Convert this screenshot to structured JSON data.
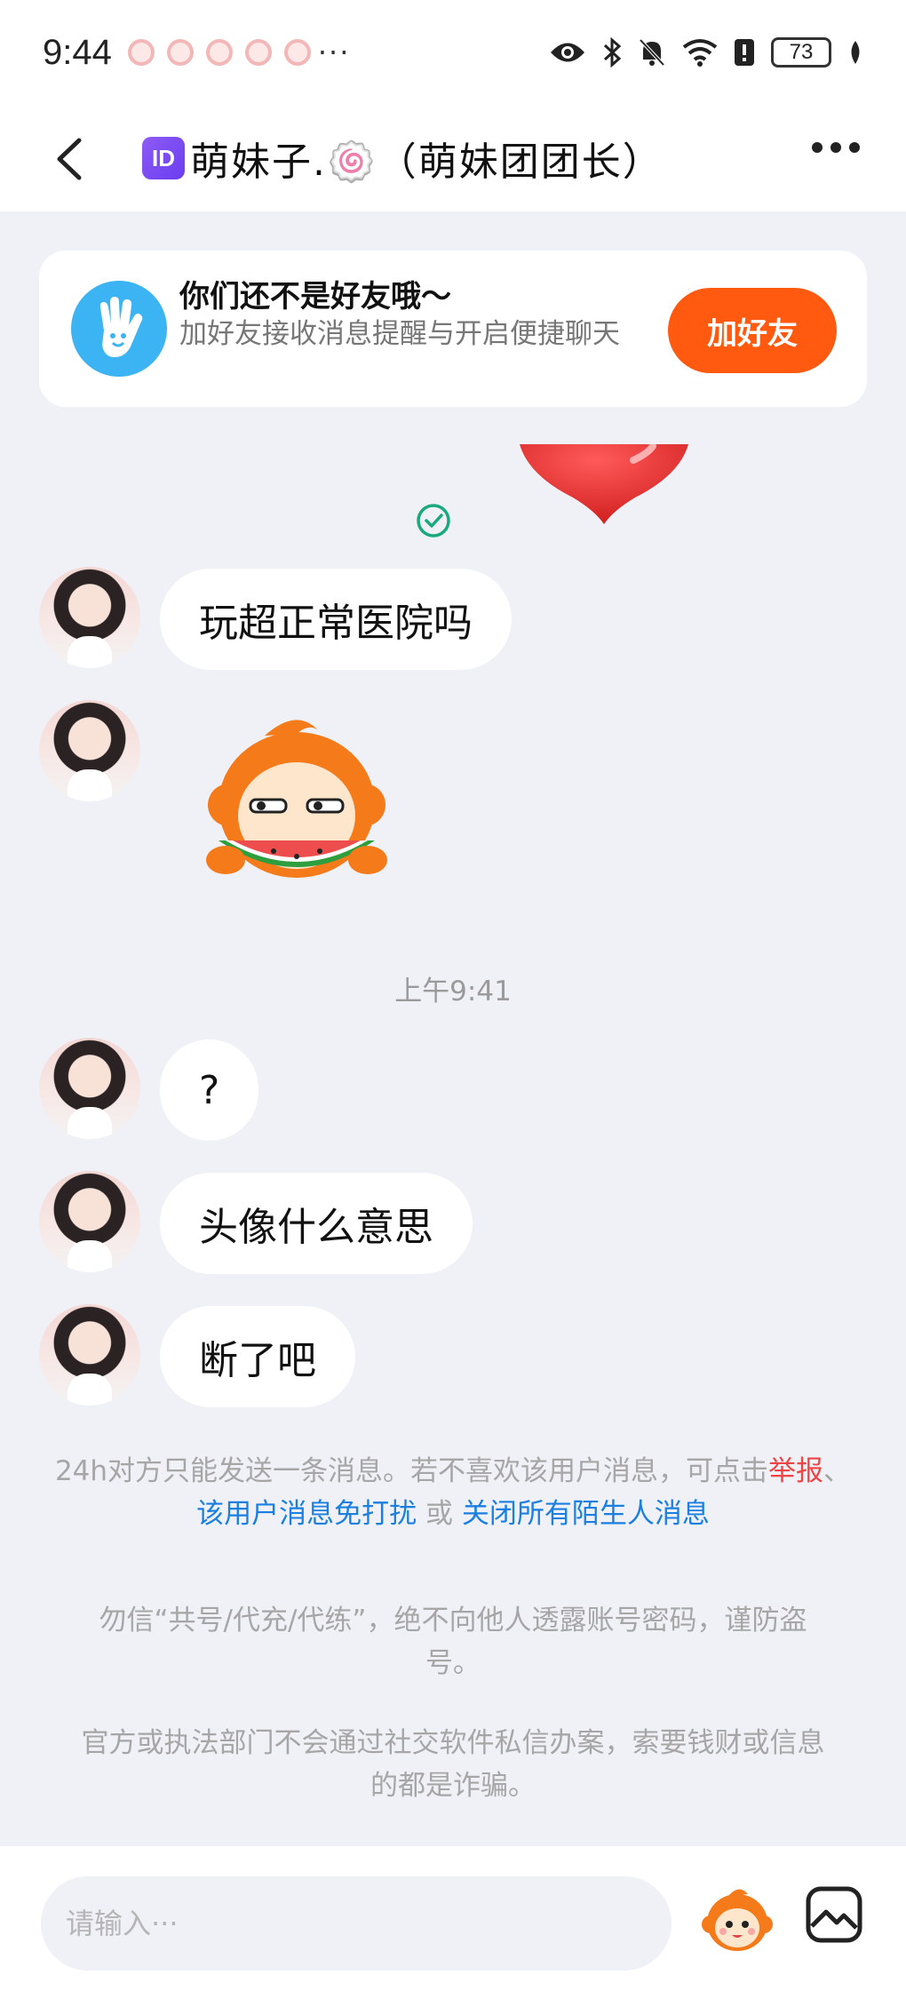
{
  "status_bar": {
    "time": "9:44",
    "overflow": "···",
    "battery": "73",
    "icons": [
      "eye-icon",
      "bluetooth-icon",
      "mute-bell-icon",
      "wifi-icon",
      "alert-icon",
      "battery-icon",
      "leaf-icon"
    ]
  },
  "header": {
    "id_badge": "ID",
    "title": "萌妹子.🍥（萌妹团团长）"
  },
  "friend_banner": {
    "title": "你们还不是好友哦～",
    "subtitle": "加好友接收消息提醒与开启便捷聊天",
    "button": "加好友"
  },
  "messages": [
    {
      "type": "text",
      "text": "玩超正常医院吗"
    },
    {
      "type": "sticker",
      "sticker": "watermelon-monkey-sticker"
    },
    {
      "type": "text",
      "text": "?"
    },
    {
      "type": "text",
      "text": "头像什么意思"
    },
    {
      "type": "text",
      "text": "断了吧"
    }
  ],
  "timestamp": "上午9:41",
  "notice": {
    "part1": "24h对方只能发送一条消息。若不喜欢该用户消息，可点击",
    "report": "举报",
    "sep1": "、",
    "mute_user": "该用户消息免打扰",
    "sep2": " 或 ",
    "close_all": "关闭所有陌生人消息"
  },
  "warnings": [
    "勿信“共号/代充/代练”，绝不向他人透露账号密码，谨防盗号。",
    "官方或执法部门不会通过社交软件私信办案，索要钱财或信息的都是诈骗。"
  ],
  "input": {
    "placeholder": "请输入···"
  },
  "colors": {
    "accent_orange": "#ff5a10",
    "link_blue": "#1a7fe0",
    "link_red": "#f04444",
    "banner_icon_blue": "#3cb3f3",
    "background": "#eff1f7"
  }
}
